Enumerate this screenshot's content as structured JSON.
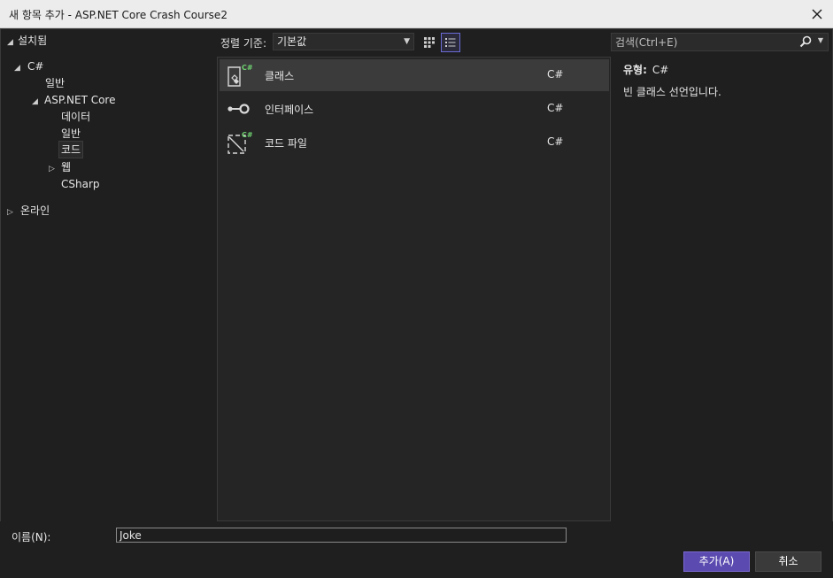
{
  "window": {
    "title": "새 항목 추가 - ASP.NET Core Crash Course2"
  },
  "tree": {
    "installed": "설치됨",
    "csharp": "C#",
    "general": "일반",
    "aspnetcore": "ASP.NET Core",
    "data": "데이터",
    "general2": "일반",
    "code": "코드",
    "web": "웹",
    "csharp2": "CSharp",
    "online": "온라인"
  },
  "toolbar": {
    "sort_label": "정렬 기준:",
    "sort_value": "기본값"
  },
  "search": {
    "placeholder": "검색(Ctrl+E)"
  },
  "items": [
    {
      "name": "클래스",
      "lang": "C#",
      "icon": "class-icon",
      "selected": true
    },
    {
      "name": "인터페이스",
      "lang": "C#",
      "icon": "interface-icon",
      "selected": false
    },
    {
      "name": "코드 파일",
      "lang": "C#",
      "icon": "code-file-icon",
      "selected": false
    }
  ],
  "detail": {
    "type_label": "유형:",
    "type_value": "C#",
    "description": "빈 클래스 선언입니다."
  },
  "footer": {
    "name_label": "이름(N):",
    "name_value": "Joke",
    "add_label": "추가(A)",
    "cancel_label": "취소"
  },
  "colors": {
    "background": "#1f1f1f",
    "panel": "#252526",
    "selected_row": "#3b3b3c",
    "accent": "#5b4bb0",
    "csharp_badge": "#6fd26f"
  }
}
